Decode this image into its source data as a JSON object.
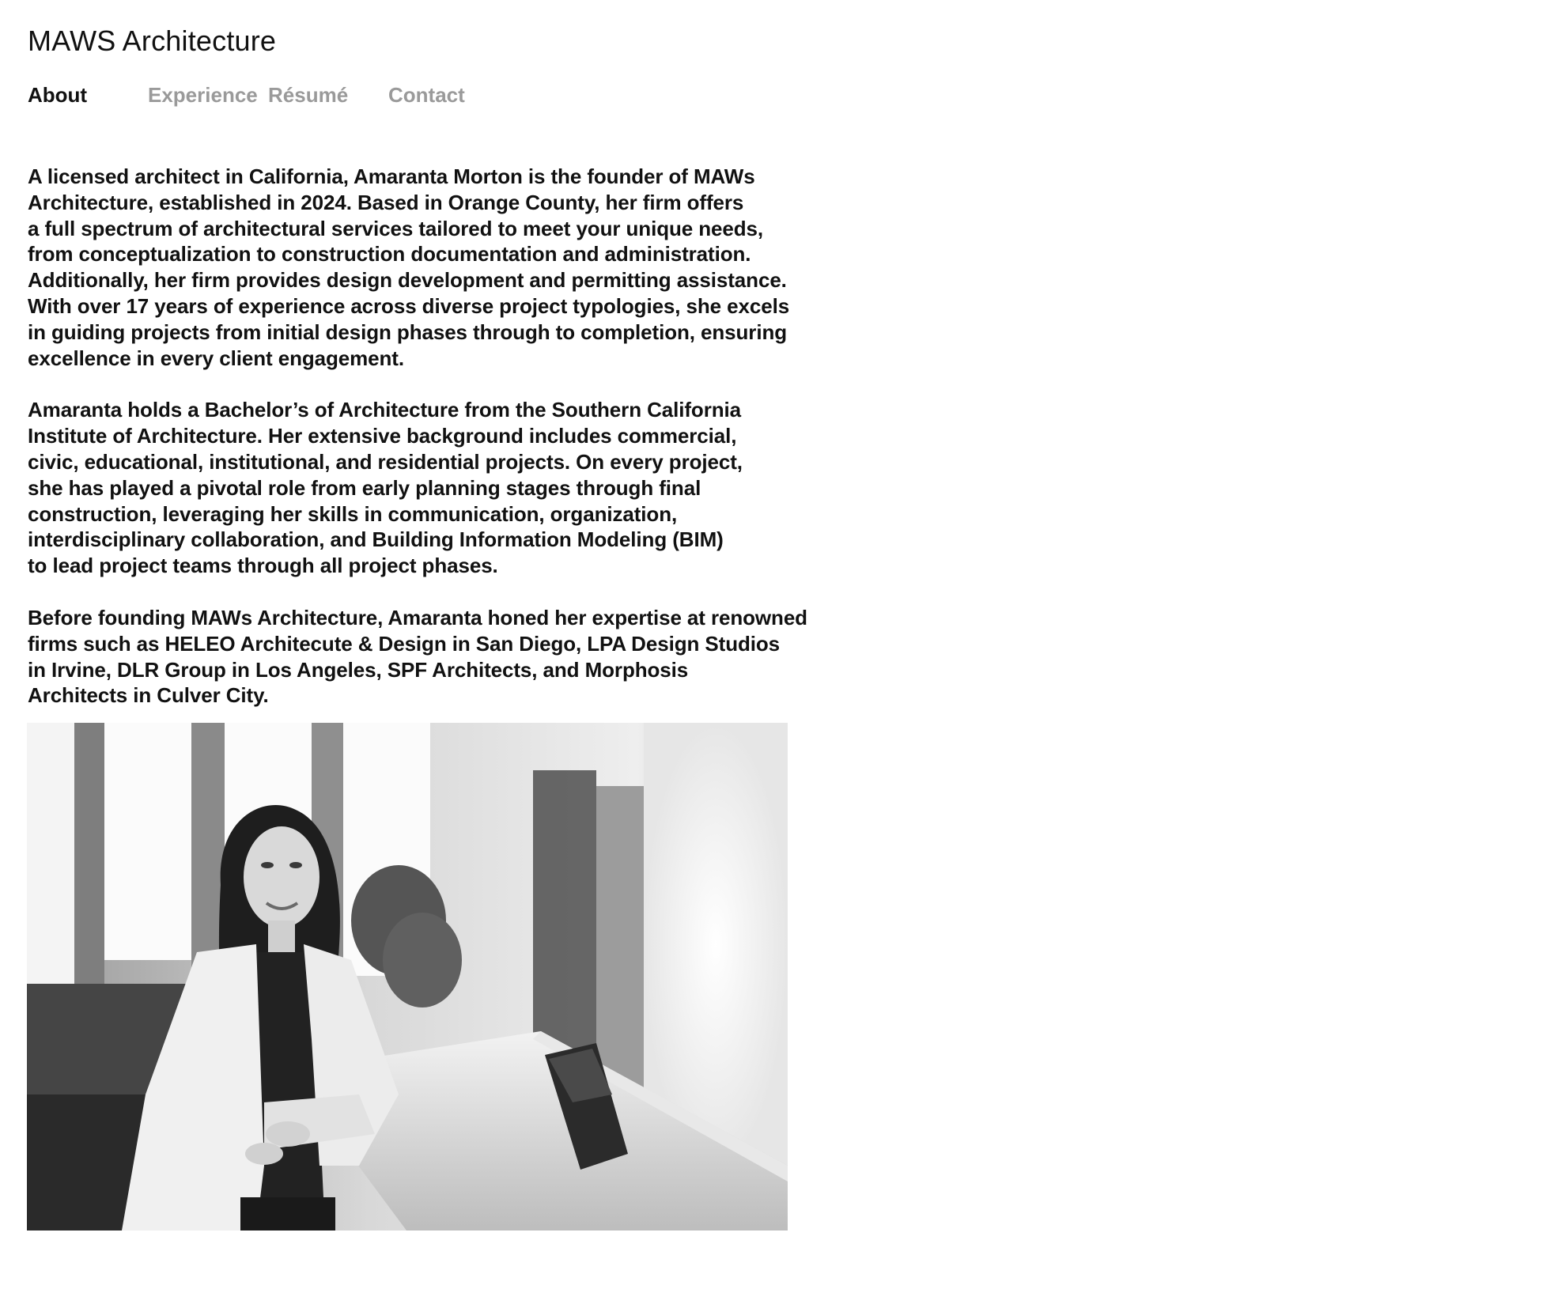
{
  "site": {
    "title": "MAWS Architecture"
  },
  "nav": {
    "items": [
      {
        "label": "About",
        "active": true
      },
      {
        "label": "Experience",
        "active": false
      },
      {
        "label": "Résumé",
        "active": false
      },
      {
        "label": "Contact",
        "active": false
      }
    ]
  },
  "about": {
    "paragraphs": [
      "A licensed architect in California, Amaranta Morton is the founder of MAWs\nArchitecture, established in 2024. Based in Orange County, her firm offers\na full spectrum of architectural services tailored to meet your unique needs,\nfrom conceptualization to construction documentation and administration.\nAdditionally, her firm provides design development and permitting assistance.\nWith over 17 years of experience across diverse project typologies, she excels\nin guiding projects from initial design phases through to completion, ensuring\nexcellence in every client engagement.",
      "Amaranta holds a Bachelor’s of Architecture from the Southern California\nInstitute of Architecture. Her extensive background includes commercial,\ncivic, educational, institutional, and residential projects. On every project,\nshe has played a pivotal role from early planning stages through final\nconstruction, leveraging her skills in communication, organization,\ninterdisciplinary collaboration, and Building Information Modeling (BIM)\nto lead project teams through all project phases.",
      "Before founding MAWs Architecture, Amaranta honed her expertise at renowned\nfirms such as HELEO Architecute & Design in San Diego, LPA Design Studios\nin Irvine, DLR Group in Los Angeles, SPF Architects, and Morphosis\nArchitects in Culver City."
    ]
  },
  "colors": {
    "text": "#111111",
    "nav_inactive": "#9a9a9a",
    "background": "#ffffff"
  }
}
